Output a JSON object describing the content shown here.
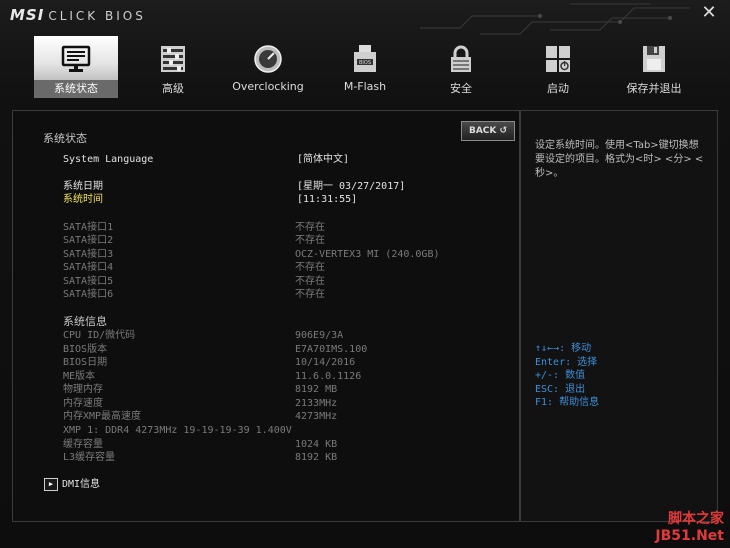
{
  "header": {
    "logo_brand": "MSI",
    "logo_product": "CLICK BIOS",
    "close_label": "✕"
  },
  "tabs": [
    {
      "id": "system-status",
      "label": "系统状态",
      "active": true
    },
    {
      "id": "advanced",
      "label": "高级"
    },
    {
      "id": "overclocking",
      "label": "Overclocking"
    },
    {
      "id": "mflash",
      "label": "M-Flash"
    },
    {
      "id": "security",
      "label": "安全"
    },
    {
      "id": "boot",
      "label": "启动"
    },
    {
      "id": "save-exit",
      "label": "保存并退出"
    }
  ],
  "main": {
    "back_label": "BACK ↺",
    "section_title": "系统状态",
    "system_language_label": "System Language",
    "system_language_value": "[简体中文]",
    "system_date_label": "系统日期",
    "system_date_value": "[星期一  03/27/2017]",
    "system_time_label": "系统时间",
    "system_time_value": "[11:31:55]",
    "sata_ports": [
      {
        "label": "SATA接口1",
        "value": "不存在"
      },
      {
        "label": "SATA接口2",
        "value": "不存在"
      },
      {
        "label": "SATA接口3",
        "value": "OCZ-VERTEX3 MI (240.0GB)"
      },
      {
        "label": "SATA接口4",
        "value": "不存在"
      },
      {
        "label": "SATA接口5",
        "value": "不存在"
      },
      {
        "label": "SATA接口6",
        "value": "不存在"
      }
    ],
    "system_info_title": "系统信息",
    "system_info": [
      {
        "label": "CPU ID/微代码",
        "value": "906E9/3A"
      },
      {
        "label": "BIOS版本",
        "value": "E7A70IMS.100"
      },
      {
        "label": "BIOS日期",
        "value": "10/14/2016"
      },
      {
        "label": "ME版本",
        "value": "11.6.0.1126"
      },
      {
        "label": "物理内存",
        "value": "8192 MB"
      },
      {
        "label": "内存速度",
        "value": "2133MHz"
      },
      {
        "label": "内存XMP最高速度",
        "value": "4273MHz"
      }
    ],
    "xmp_line": "XMP 1: DDR4 4273MHz 19-19-19-39 1.400V",
    "cache_info": [
      {
        "label": "缓存容量",
        "value": "1024 KB"
      },
      {
        "label": "L3缓存容量",
        "value": "8192 KB"
      }
    ],
    "dmi_label": "DMI信息"
  },
  "help": {
    "description": "设定系统时间。使用<Tab>键切换想要设定的项目。格式为<时> <分> <秒>。",
    "keys": [
      {
        "text": "↑↓←→: 移动"
      },
      {
        "text": "Enter: 选择"
      },
      {
        "text": "+/-: 数值"
      },
      {
        "text": "ESC: 退出"
      },
      {
        "text": "F1: 帮助信息"
      }
    ]
  },
  "watermark": {
    "line1": "脚本之家",
    "line2": "JB51.Net"
  }
}
